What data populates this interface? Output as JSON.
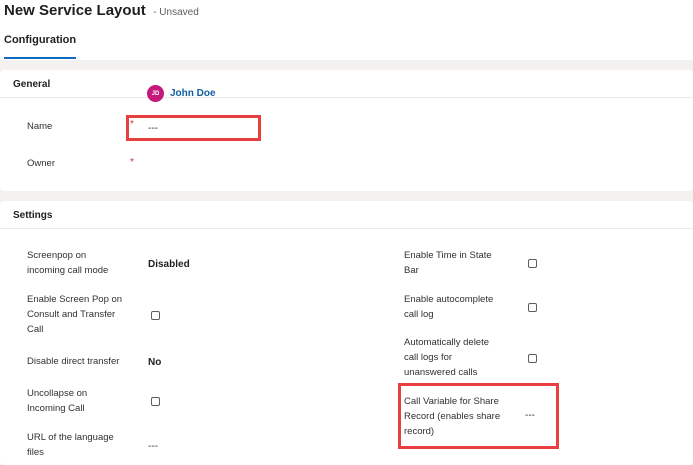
{
  "header": {
    "title": "New Service Layout",
    "status": "- Unsaved",
    "tabs": [
      {
        "label": "Configuration"
      }
    ]
  },
  "general": {
    "title": "General",
    "name_label": "Name",
    "name_value": "---",
    "owner_label": "Owner",
    "owner_initials": "JD",
    "owner_name": "John Doe",
    "required_marker": "*"
  },
  "settings": {
    "title": "Settings",
    "screenpop_label": [
      "Screenpop on",
      "incoming call mode"
    ],
    "screenpop_value": "Disabled",
    "consult_label": [
      "Enable Screen Pop on",
      "Consult and Transfer",
      "Call"
    ],
    "consult_checked": false,
    "direct_transfer_label": "Disable direct transfer",
    "direct_transfer_value": "No",
    "uncollapse_label": [
      "Uncollapse on",
      "Incoming Call"
    ],
    "uncollapse_checked": false,
    "language_label": [
      "URL of the language",
      "files"
    ],
    "language_value": "---",
    "time_state_label": [
      "Enable Time in State",
      "Bar"
    ],
    "time_state_checked": false,
    "autocomplete_label": [
      "Enable autocomplete",
      "call log"
    ],
    "autocomplete_checked": false,
    "auto_delete_label": [
      "Automatically delete",
      "call logs for",
      "unanswered calls"
    ],
    "auto_delete_checked": false,
    "call_variable_label": [
      "Call Variable for Share",
      "Record (enables share",
      "record)"
    ],
    "call_variable_value": "---"
  },
  "colors": {
    "highlight": "#e8403f",
    "accent": "#0f6cbd",
    "avatar": "#c4197a",
    "required": "#d13438"
  }
}
